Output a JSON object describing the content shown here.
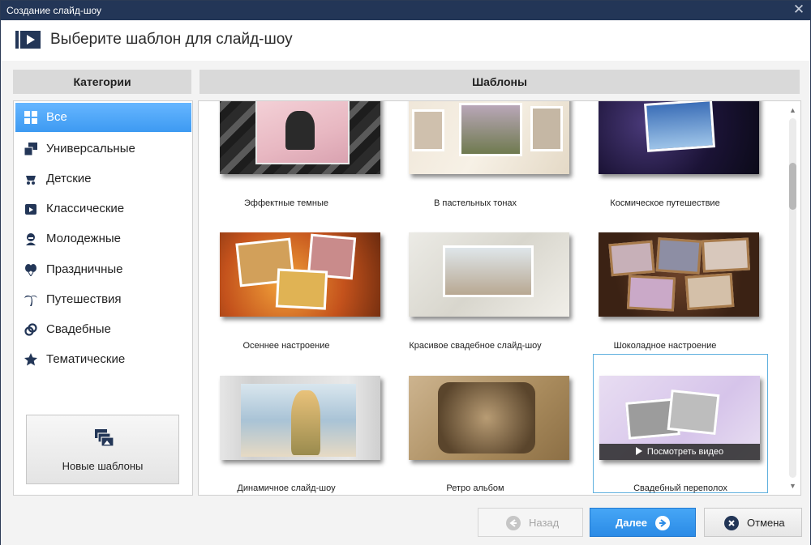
{
  "window": {
    "title": "Создание слайд-шоу",
    "close": "✕"
  },
  "header": {
    "title": "Выберите шаблон для слайд-шоу"
  },
  "categories": {
    "heading": "Категории",
    "items": [
      {
        "label": "Все",
        "icon": "grid-icon",
        "active": true
      },
      {
        "label": "Универсальные",
        "icon": "stack-icon"
      },
      {
        "label": "Детские",
        "icon": "stroller-icon"
      },
      {
        "label": "Классические",
        "icon": "film-icon"
      },
      {
        "label": "Молодежные",
        "icon": "person-icon"
      },
      {
        "label": "Праздничные",
        "icon": "balloons-icon"
      },
      {
        "label": "Путешествия",
        "icon": "palm-icon"
      },
      {
        "label": "Свадебные",
        "icon": "rings-icon"
      },
      {
        "label": "Тематические",
        "icon": "star-icon"
      }
    ],
    "new_templates": "Новые шаблоны"
  },
  "templates": {
    "heading": "Шаблоны",
    "items": [
      {
        "label": "Эффектные темные"
      },
      {
        "label": "В пастельных тонах"
      },
      {
        "label": "Космическое путешествие"
      },
      {
        "label": "Осеннее настроение"
      },
      {
        "label": "Красивое свадебное слайд-шоу"
      },
      {
        "label": "Шоколадное настроение"
      },
      {
        "label": "Динамичное слайд-шоу"
      },
      {
        "label": "Ретро альбом"
      },
      {
        "label": "Свадебный переполох",
        "selected": true
      }
    ],
    "watch_video": "Посмотреть видео"
  },
  "footer": {
    "back": "Назад",
    "next": "Далее",
    "cancel": "Отмена"
  },
  "colors": {
    "titlebar": "#233657",
    "accent": "#3d9af2"
  }
}
